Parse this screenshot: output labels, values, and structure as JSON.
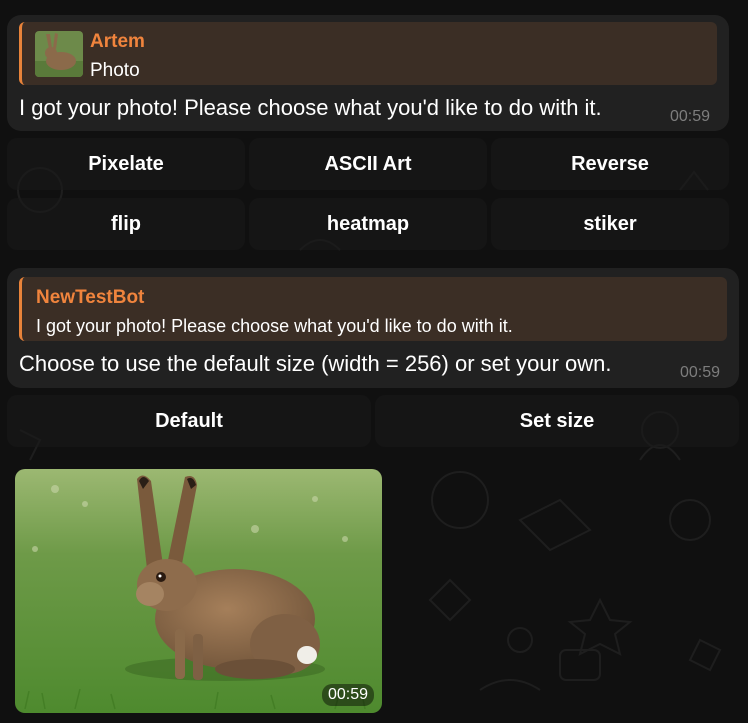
{
  "colors": {
    "accent": "#e8833a",
    "bubble": "#212121",
    "reply_bg": "#3b2e25",
    "background": "#101010"
  },
  "message1": {
    "reply": {
      "name": "Artem",
      "text": "Photo",
      "thumb_icon": "hare-thumbnail"
    },
    "text": "I got your photo! Please choose what you'd like to do with it.",
    "time": "00:59",
    "keyboard": [
      [
        "Pixelate",
        "ASCII Art",
        "Reverse"
      ],
      [
        "flip",
        "heatmap",
        "stiker"
      ]
    ]
  },
  "message2": {
    "reply": {
      "name": "NewTestBot",
      "text": "I got your photo! Please choose what you'd like to do with it."
    },
    "text": "Choose to use the default size (width = 256) or set your own.",
    "time": "00:59",
    "keyboard": [
      [
        "Default",
        "Set size"
      ]
    ]
  },
  "photo_message": {
    "image": "hare-photo",
    "time": "00:59"
  }
}
